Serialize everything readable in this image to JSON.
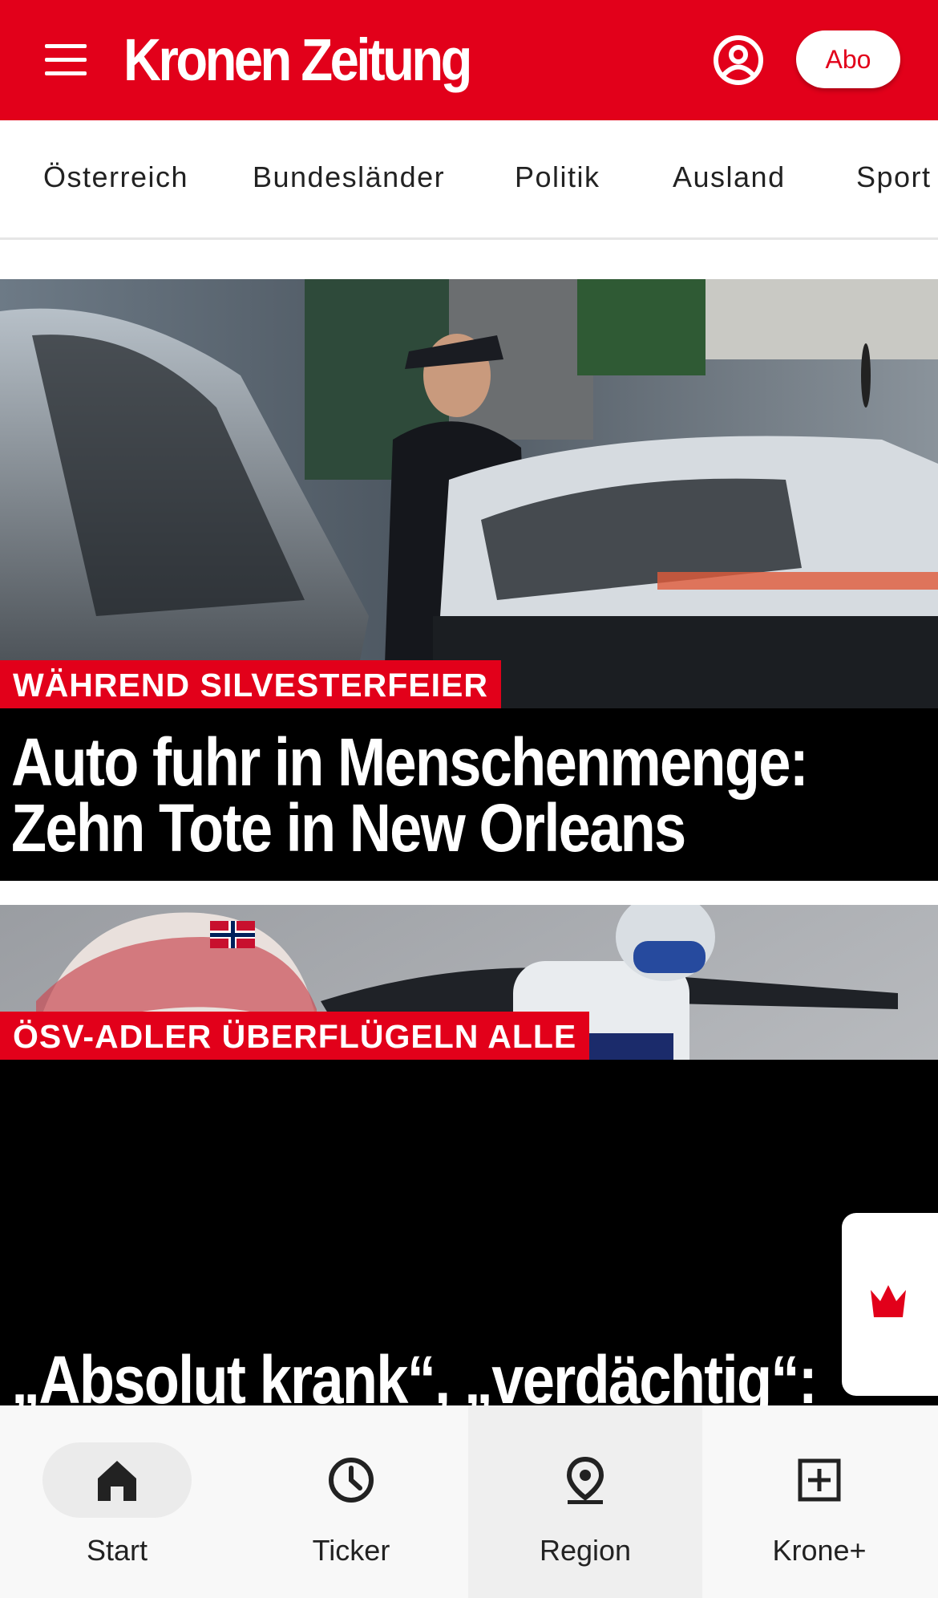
{
  "header": {
    "brand": "Kronen Zeitung",
    "abo_label": "Abo",
    "menu_icon": "hamburger-icon",
    "account_icon": "account-icon"
  },
  "categories": [
    "Österreich",
    "Bundesländer",
    "Politik",
    "Ausland",
    "Sport"
  ],
  "articles": [
    {
      "kicker": "WÄHREND SILVESTERFEIER",
      "headline_line1": "Auto fuhr in Menschenmenge:",
      "headline_line2": "Zehn Tote in New Orleans"
    },
    {
      "kicker": "ÖSV-ADLER ÜBERFLÜGELN ALLE",
      "headline_line1": "„Absolut krank“, „verdächtig“:"
    }
  ],
  "bottom_nav": [
    {
      "label": "Start",
      "icon": "home-icon",
      "active": true
    },
    {
      "label": "Ticker",
      "icon": "clock-icon",
      "active": false
    },
    {
      "label": "Region",
      "icon": "location-pin-icon",
      "active": false
    },
    {
      "label": "Krone+",
      "icon": "plus-box-icon",
      "active": false
    }
  ],
  "colors": {
    "brand_red": "#e2001a",
    "nav_bg": "#f8f8f8",
    "text_dark": "#222222"
  }
}
